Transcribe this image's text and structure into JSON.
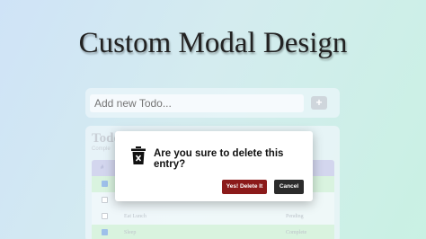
{
  "page_title": "Custom Modal Design",
  "add_todo": {
    "placeholder": "Add new Todo...",
    "add_label": "+"
  },
  "todo_list": {
    "title": "Todo",
    "subtitle": "Comple",
    "header_num": "#",
    "rows": [
      {
        "checked": true,
        "text": "",
        "status": ""
      },
      {
        "checked": false,
        "text": "",
        "status": ""
      },
      {
        "checked": false,
        "text": "Eat Lunch",
        "status": "Pending"
      },
      {
        "checked": true,
        "text": "Sleep",
        "status": "Complete"
      }
    ]
  },
  "modal": {
    "message": "Are you sure to delete this entry?",
    "confirm_label": "Yes! Delete It",
    "cancel_label": "Cancel",
    "icon": "trash-icon"
  },
  "colors": {
    "delete_button": "#8b1a1a",
    "cancel_button": "#2b2b2b",
    "row_green": "#d9f3df"
  }
}
